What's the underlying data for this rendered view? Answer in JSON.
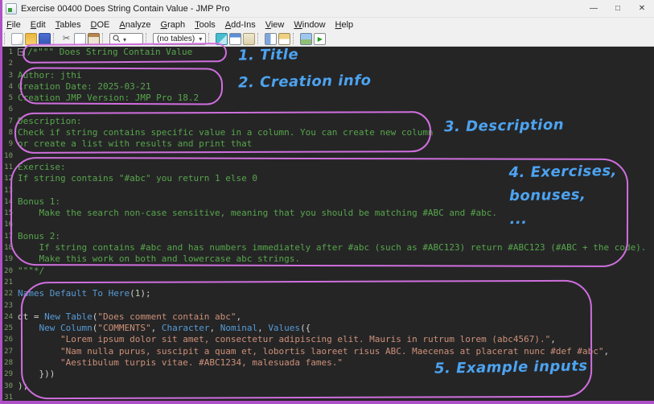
{
  "window": {
    "title": "Exercise 00400 Does String Contain Value - JMP Pro",
    "controls": {
      "minimize": "—",
      "maximize": "□",
      "close": "✕"
    }
  },
  "menu": {
    "items": [
      {
        "label": "File",
        "u": 0
      },
      {
        "label": "Edit",
        "u": 0
      },
      {
        "label": "Tables",
        "u": 0
      },
      {
        "label": "DOE",
        "u": 0
      },
      {
        "label": "Analyze",
        "u": 0
      },
      {
        "label": "Graph",
        "u": 0
      },
      {
        "label": "Tools",
        "u": 0
      },
      {
        "label": "Add-Ins",
        "u": 0
      },
      {
        "label": "View",
        "u": 0
      },
      {
        "label": "Window",
        "u": 0
      },
      {
        "label": "Help",
        "u": 0
      }
    ]
  },
  "toolbar": {
    "combo_value": "(no tables)",
    "icons": [
      "new-journal",
      "open-file",
      "save",
      "cut",
      "copy",
      "paste",
      "search",
      "tables-combo",
      "ruler",
      "data-table",
      "journal",
      "layout-vertical",
      "layout-horizontal",
      "image",
      "run-script"
    ]
  },
  "editor": {
    "lines": [
      {
        "n": 1,
        "fold": true,
        "segs": [
          [
            "/*\"\"\" Does String Contain Value",
            "c"
          ]
        ]
      },
      {
        "n": 2,
        "segs": []
      },
      {
        "n": 3,
        "segs": [
          [
            "Author: jthi",
            "c"
          ]
        ]
      },
      {
        "n": 4,
        "segs": [
          [
            "Creation Date: 2025-03-21",
            "c"
          ]
        ]
      },
      {
        "n": 5,
        "segs": [
          [
            "Creation JMP Version: JMP Pro 18.2",
            "c"
          ]
        ]
      },
      {
        "n": 6,
        "segs": []
      },
      {
        "n": 7,
        "segs": [
          [
            "Description:",
            "c"
          ]
        ]
      },
      {
        "n": 8,
        "segs": [
          [
            "Check if string contains specific value in a column. You can create new column",
            "c"
          ]
        ]
      },
      {
        "n": 9,
        "segs": [
          [
            "or create a list with results and print that",
            "c"
          ]
        ]
      },
      {
        "n": 10,
        "segs": []
      },
      {
        "n": 11,
        "segs": [
          [
            "Exercise:",
            "c"
          ]
        ]
      },
      {
        "n": 12,
        "segs": [
          [
            "If string contains \"#abc\" you return 1 else 0",
            "c"
          ]
        ]
      },
      {
        "n": 13,
        "segs": []
      },
      {
        "n": 14,
        "segs": [
          [
            "Bonus 1:",
            "c"
          ]
        ]
      },
      {
        "n": 15,
        "segs": [
          [
            "    Make the search non-case sensitive, meaning that you should be matching #ABC and #abc.",
            "c"
          ]
        ]
      },
      {
        "n": 16,
        "segs": []
      },
      {
        "n": 17,
        "segs": [
          [
            "Bonus 2:",
            "c"
          ]
        ]
      },
      {
        "n": 18,
        "segs": [
          [
            "    If string contains #abc and has numbers immediately after #abc (such as #ABC123) return #ABC123 (#ABC + the code).",
            "c"
          ]
        ]
      },
      {
        "n": 19,
        "segs": [
          [
            "    Make this work on both and lowercase abc strings.",
            "c"
          ]
        ]
      },
      {
        "n": 20,
        "segs": [
          [
            "\"\"\"*/",
            "c"
          ]
        ]
      },
      {
        "n": 21,
        "segs": []
      },
      {
        "n": 22,
        "segs": [
          [
            "Names Default To Here",
            "k"
          ],
          [
            "(",
            "p"
          ],
          [
            "1",
            "num"
          ],
          [
            ");",
            "p"
          ]
        ]
      },
      {
        "n": 23,
        "segs": []
      },
      {
        "n": 24,
        "segs": [
          [
            "dt = ",
            "p"
          ],
          [
            "New Table",
            "k"
          ],
          [
            "(",
            "p"
          ],
          [
            "\"Does comment contain abc\"",
            "s"
          ],
          [
            ",",
            "p"
          ]
        ]
      },
      {
        "n": 25,
        "segs": [
          [
            "    ",
            "p"
          ],
          [
            "New Column",
            "k"
          ],
          [
            "(",
            "p"
          ],
          [
            "\"COMMENTS\"",
            "s"
          ],
          [
            ", ",
            "p"
          ],
          [
            "Character",
            "k"
          ],
          [
            ", ",
            "p"
          ],
          [
            "Nominal",
            "k"
          ],
          [
            ", ",
            "p"
          ],
          [
            "Values",
            "k"
          ],
          [
            "({",
            "p"
          ]
        ]
      },
      {
        "n": 26,
        "segs": [
          [
            "        ",
            "p"
          ],
          [
            "\"Lorem ipsum dolor sit amet, consectetur adipiscing elit. Mauris in rutrum lorem (abc4567).\"",
            "s"
          ],
          [
            ",",
            "p"
          ]
        ]
      },
      {
        "n": 27,
        "segs": [
          [
            "        ",
            "p"
          ],
          [
            "\"Nam nulla purus, suscipit a quam et, lobortis laoreet risus ABC. Maecenas at placerat nunc #def #abc\"",
            "s"
          ],
          [
            ",",
            "p"
          ]
        ]
      },
      {
        "n": 28,
        "segs": [
          [
            "        ",
            "p"
          ],
          [
            "\"Aestibulum turpis vitae. #ABC1234, malesuada fames.\"",
            "s"
          ]
        ]
      },
      {
        "n": 29,
        "segs": [
          [
            "    }))",
            "p"
          ]
        ]
      },
      {
        "n": 30,
        "segs": [
          [
            ");",
            "p"
          ]
        ]
      },
      {
        "n": 31,
        "segs": []
      }
    ]
  },
  "annotations": {
    "label1": "1. Title",
    "label2": "2. Creation info",
    "label3": "3. Description",
    "label4_line1": "4. Exercises,",
    "label4_line2": "bonuses,",
    "label4_line3": "...",
    "label5": "5. Example inputs",
    "accent_purple": "#cf6fdd",
    "accent_blue": "#4da3f0"
  }
}
